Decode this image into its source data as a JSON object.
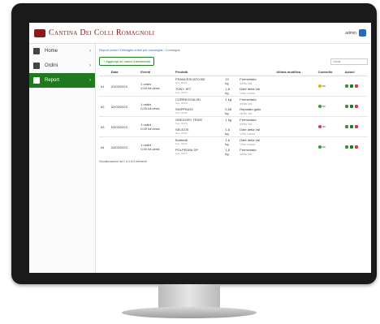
{
  "app": {
    "brand": "Cantina Dei Colli Romagnoli",
    "user": "admin"
  },
  "nav": [
    {
      "label": "Home",
      "icon": "home-icon",
      "active": false
    },
    {
      "label": "Ordini",
      "icon": "orders-icon",
      "active": false
    },
    {
      "label": "Report",
      "icon": "report-icon",
      "active": true
    }
  ],
  "breadcrumb": {
    "root": "Report ordini",
    "middle": "Dettaglio ordini per consegna",
    "current": "Consegne"
  },
  "toolbar": {
    "add_label": "+ Aggiungi un nuovo inserimento",
    "search_placeholder": "Cerca"
  },
  "table": {
    "headers": [
      "",
      "Data",
      "Eventi",
      "Prodotti",
      "",
      "",
      "Ultima modifica",
      "Controllo",
      "Azioni"
    ],
    "groups": [
      {
        "num": "#1",
        "date": "01/03/2023",
        "eventi": [
          "1 ordini",
          "0,00 tot.vend."
        ],
        "rows": [
          {
            "prod": "FRANCESCATO BD",
            "code": "Seq. 00/00",
            "qty": "12",
            "unit": "kg",
            "desc": "Fermentato",
            "desc2": "della Val"
          },
          {
            "prod": "TONY JET",
            "code": "Seq. 00/00",
            "qty": "1,6",
            "unit": "kg",
            "desc": "Date della Val",
            "desc2": "Vino rosso"
          }
        ],
        "status": "ok",
        "status_label": "no"
      },
      {
        "num": "#2",
        "date": "02/03/2023",
        "eventi": [
          "1 ordini",
          "0,00 tot.vend."
        ],
        "rows": [
          {
            "prod": "CORREGGIA HD",
            "code": "Seq. 00/00",
            "qty": "1 kg",
            "unit": "",
            "desc": "Fermentato",
            "desc2": "della Val"
          },
          {
            "prod": "SHIPPINGS",
            "code": "Seq. 00/00",
            "qty": "0,06",
            "unit": "kg",
            "desc": "Reputato gallo",
            "desc2": "della Val"
          }
        ],
        "status": "ok",
        "status_label": "no"
      },
      {
        "num": "#3",
        "date": "03/03/2023",
        "eventi": [
          "1 ordini",
          "0,00 tot.vend."
        ],
        "rows": [
          {
            "prod": "GREGORY TRIVE",
            "code": "Seq. 00/00",
            "qty": "1 kg",
            "unit": "",
            "desc": "Fermentato",
            "desc2": "della Val"
          },
          {
            "prod": "SELEZIS",
            "code": "Seq. 00/00",
            "qty": "1,6",
            "unit": "kg",
            "desc": "Date della Val",
            "desc2": "Vino rosso"
          }
        ],
        "status": "bad",
        "status_label": "no"
      },
      {
        "num": "#4",
        "date": "04/03/2023",
        "eventi": [
          "1 ordini",
          "0,00 tot.vend."
        ],
        "rows": [
          {
            "prod": "Bottinelli",
            "code": "Seq. 00/00",
            "qty": "1,6",
            "unit": "kg",
            "desc": "Date della Val",
            "desc2": "Vino rosso"
          },
          {
            "prod": "POLPEDINI DP",
            "code": "Seq. 00/00",
            "qty": "1,6",
            "unit": "kg",
            "desc": "Fermentato",
            "desc2": "della Val"
          }
        ],
        "status": "ok",
        "status_label": "no"
      }
    ]
  },
  "footer": "Visualizzazione da 1 a 4 di 4 elementi",
  "colors": {
    "accent": "#1f7a1f",
    "brand": "#7a1f1f",
    "ok": "#2e9e2e",
    "bad": "#d23b5a",
    "warn": "#e1b400"
  }
}
